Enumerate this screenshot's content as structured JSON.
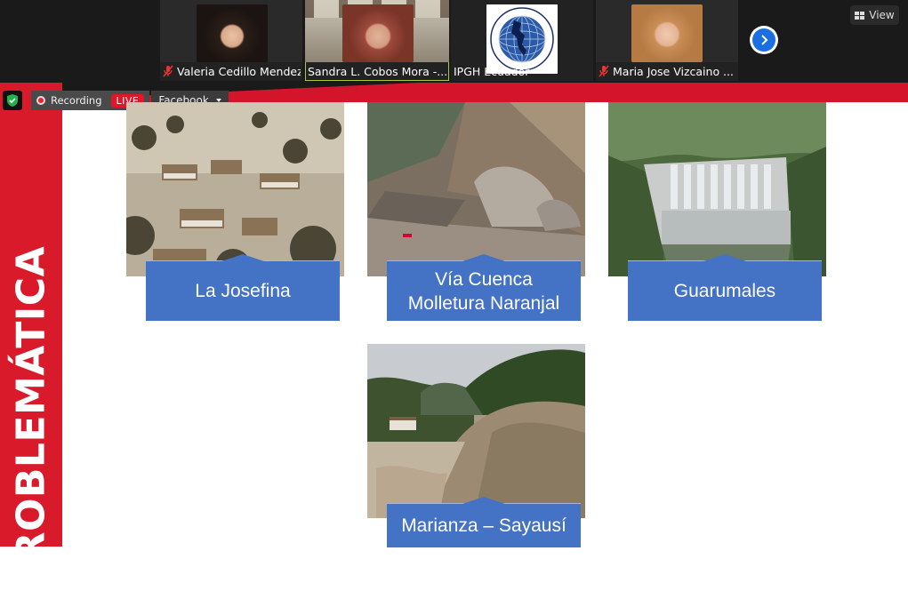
{
  "participants": [
    {
      "name": "Valeria Cedillo Mendez",
      "muted": true
    },
    {
      "name": "Sandra L. Cobos Mora -...",
      "muted": false
    },
    {
      "name": "IPGH Ecuador",
      "muted": false
    },
    {
      "name": "Maria Jose Vizcaino ...",
      "muted": true
    }
  ],
  "toolbar": {
    "view_label": "View"
  },
  "recording": {
    "label": "Recording",
    "live_badge": "LIVE",
    "stream_target": "Facebook"
  },
  "slide": {
    "title": "PROBLEMÁTICA",
    "items": [
      {
        "caption": "La Josefina"
      },
      {
        "caption": "Vía Cuenca Molletura Naranjal"
      },
      {
        "caption": "Guarumales"
      },
      {
        "caption": "Marianza – Sayausí"
      }
    ]
  },
  "colors": {
    "slide_red": "#d91a2a",
    "caption_blue": "#4472c4",
    "live_red": "#e0162b",
    "next_blue": "#1b6fe0"
  }
}
